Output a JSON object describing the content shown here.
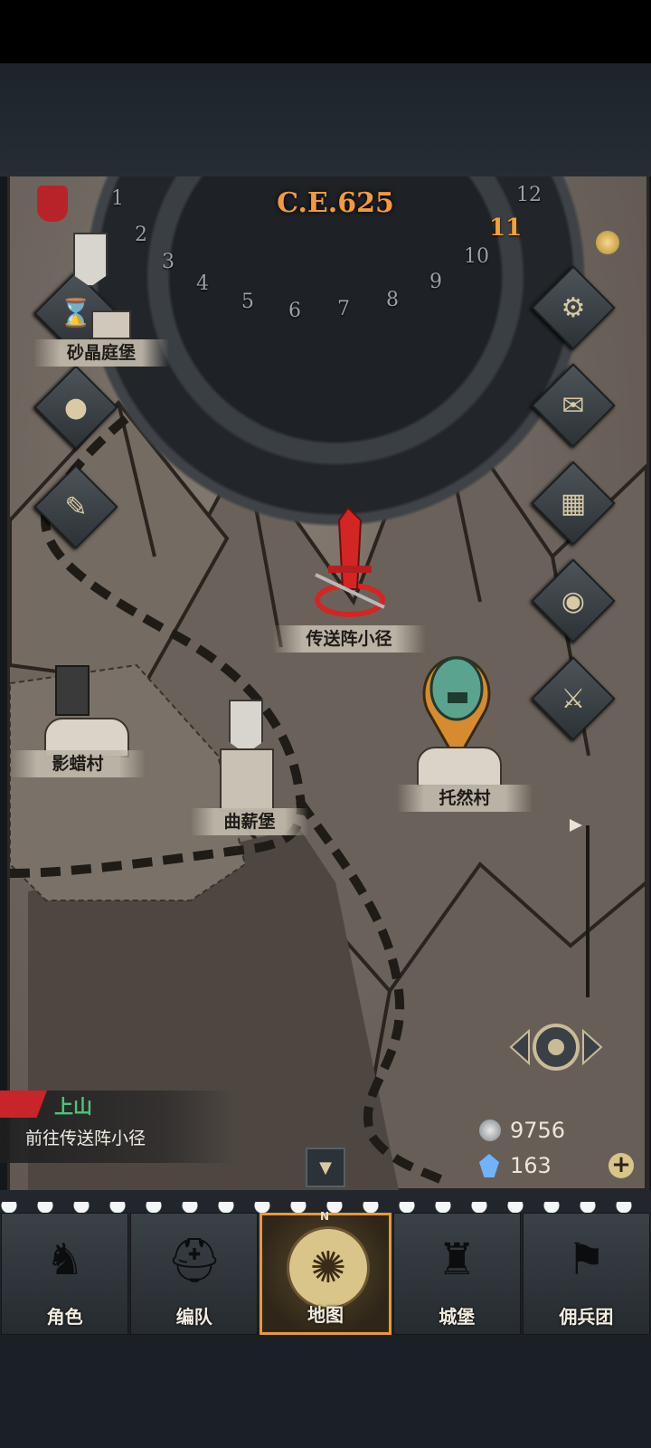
{
  "calendar": {
    "year": "C.E.625",
    "months": [
      "1",
      "2",
      "3",
      "4",
      "5",
      "6",
      "7",
      "8",
      "9",
      "10",
      "11",
      "12"
    ],
    "current_month": "11"
  },
  "locations": {
    "sand_crystal_castle": "砂晶庭堡",
    "teleport_path": "传送阵小径",
    "shadow_village": "影蜡村",
    "qu_castle": "曲薪堡",
    "toran_village": "托然村"
  },
  "quest": {
    "title": "上山",
    "description": "前往传送阵小径"
  },
  "currency": {
    "silver": "9756",
    "crystal": "163"
  },
  "nav": {
    "items": [
      {
        "label": "角色",
        "icon": "knight-icon"
      },
      {
        "label": "编队",
        "icon": "helmet-icon"
      },
      {
        "label": "地图",
        "icon": "map-compass-icon",
        "active": true
      },
      {
        "label": "城堡",
        "icon": "castle-icon"
      },
      {
        "label": "佣兵团",
        "icon": "mercenary-icon"
      }
    ],
    "compass_n": "N"
  },
  "side_buttons": [
    "gear-icon",
    "mail-icon",
    "window-icon",
    "scroll-coin-icon",
    "soldier-icon"
  ],
  "left_buttons": [
    "hourglass-icon",
    "pouch-icon",
    "map-scroll-icon"
  ],
  "colors": {
    "accent_orange": "#f39a3a",
    "quest_green": "#4cc47a",
    "marker_red": "#d42525",
    "marker_teal": "#5aa38e"
  }
}
